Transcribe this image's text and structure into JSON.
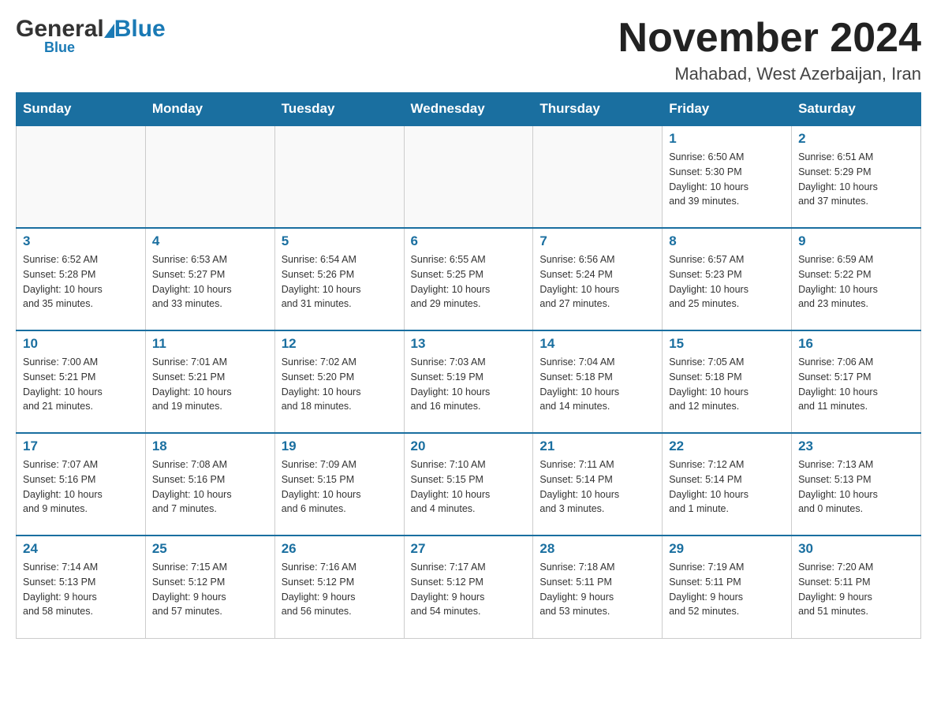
{
  "header": {
    "logo_general": "General",
    "logo_blue": "Blue",
    "logo_underline": "Blue",
    "month_title": "November 2024",
    "subtitle": "Mahabad, West Azerbaijan, Iran"
  },
  "days_of_week": [
    "Sunday",
    "Monday",
    "Tuesday",
    "Wednesday",
    "Thursday",
    "Friday",
    "Saturday"
  ],
  "weeks": [
    {
      "days": [
        {
          "number": "",
          "info": ""
        },
        {
          "number": "",
          "info": ""
        },
        {
          "number": "",
          "info": ""
        },
        {
          "number": "",
          "info": ""
        },
        {
          "number": "",
          "info": ""
        },
        {
          "number": "1",
          "info": "Sunrise: 6:50 AM\nSunset: 5:30 PM\nDaylight: 10 hours\nand 39 minutes."
        },
        {
          "number": "2",
          "info": "Sunrise: 6:51 AM\nSunset: 5:29 PM\nDaylight: 10 hours\nand 37 minutes."
        }
      ]
    },
    {
      "days": [
        {
          "number": "3",
          "info": "Sunrise: 6:52 AM\nSunset: 5:28 PM\nDaylight: 10 hours\nand 35 minutes."
        },
        {
          "number": "4",
          "info": "Sunrise: 6:53 AM\nSunset: 5:27 PM\nDaylight: 10 hours\nand 33 minutes."
        },
        {
          "number": "5",
          "info": "Sunrise: 6:54 AM\nSunset: 5:26 PM\nDaylight: 10 hours\nand 31 minutes."
        },
        {
          "number": "6",
          "info": "Sunrise: 6:55 AM\nSunset: 5:25 PM\nDaylight: 10 hours\nand 29 minutes."
        },
        {
          "number": "7",
          "info": "Sunrise: 6:56 AM\nSunset: 5:24 PM\nDaylight: 10 hours\nand 27 minutes."
        },
        {
          "number": "8",
          "info": "Sunrise: 6:57 AM\nSunset: 5:23 PM\nDaylight: 10 hours\nand 25 minutes."
        },
        {
          "number": "9",
          "info": "Sunrise: 6:59 AM\nSunset: 5:22 PM\nDaylight: 10 hours\nand 23 minutes."
        }
      ]
    },
    {
      "days": [
        {
          "number": "10",
          "info": "Sunrise: 7:00 AM\nSunset: 5:21 PM\nDaylight: 10 hours\nand 21 minutes."
        },
        {
          "number": "11",
          "info": "Sunrise: 7:01 AM\nSunset: 5:21 PM\nDaylight: 10 hours\nand 19 minutes."
        },
        {
          "number": "12",
          "info": "Sunrise: 7:02 AM\nSunset: 5:20 PM\nDaylight: 10 hours\nand 18 minutes."
        },
        {
          "number": "13",
          "info": "Sunrise: 7:03 AM\nSunset: 5:19 PM\nDaylight: 10 hours\nand 16 minutes."
        },
        {
          "number": "14",
          "info": "Sunrise: 7:04 AM\nSunset: 5:18 PM\nDaylight: 10 hours\nand 14 minutes."
        },
        {
          "number": "15",
          "info": "Sunrise: 7:05 AM\nSunset: 5:18 PM\nDaylight: 10 hours\nand 12 minutes."
        },
        {
          "number": "16",
          "info": "Sunrise: 7:06 AM\nSunset: 5:17 PM\nDaylight: 10 hours\nand 11 minutes."
        }
      ]
    },
    {
      "days": [
        {
          "number": "17",
          "info": "Sunrise: 7:07 AM\nSunset: 5:16 PM\nDaylight: 10 hours\nand 9 minutes."
        },
        {
          "number": "18",
          "info": "Sunrise: 7:08 AM\nSunset: 5:16 PM\nDaylight: 10 hours\nand 7 minutes."
        },
        {
          "number": "19",
          "info": "Sunrise: 7:09 AM\nSunset: 5:15 PM\nDaylight: 10 hours\nand 6 minutes."
        },
        {
          "number": "20",
          "info": "Sunrise: 7:10 AM\nSunset: 5:15 PM\nDaylight: 10 hours\nand 4 minutes."
        },
        {
          "number": "21",
          "info": "Sunrise: 7:11 AM\nSunset: 5:14 PM\nDaylight: 10 hours\nand 3 minutes."
        },
        {
          "number": "22",
          "info": "Sunrise: 7:12 AM\nSunset: 5:14 PM\nDaylight: 10 hours\nand 1 minute."
        },
        {
          "number": "23",
          "info": "Sunrise: 7:13 AM\nSunset: 5:13 PM\nDaylight: 10 hours\nand 0 minutes."
        }
      ]
    },
    {
      "days": [
        {
          "number": "24",
          "info": "Sunrise: 7:14 AM\nSunset: 5:13 PM\nDaylight: 9 hours\nand 58 minutes."
        },
        {
          "number": "25",
          "info": "Sunrise: 7:15 AM\nSunset: 5:12 PM\nDaylight: 9 hours\nand 57 minutes."
        },
        {
          "number": "26",
          "info": "Sunrise: 7:16 AM\nSunset: 5:12 PM\nDaylight: 9 hours\nand 56 minutes."
        },
        {
          "number": "27",
          "info": "Sunrise: 7:17 AM\nSunset: 5:12 PM\nDaylight: 9 hours\nand 54 minutes."
        },
        {
          "number": "28",
          "info": "Sunrise: 7:18 AM\nSunset: 5:11 PM\nDaylight: 9 hours\nand 53 minutes."
        },
        {
          "number": "29",
          "info": "Sunrise: 7:19 AM\nSunset: 5:11 PM\nDaylight: 9 hours\nand 52 minutes."
        },
        {
          "number": "30",
          "info": "Sunrise: 7:20 AM\nSunset: 5:11 PM\nDaylight: 9 hours\nand 51 minutes."
        }
      ]
    }
  ]
}
